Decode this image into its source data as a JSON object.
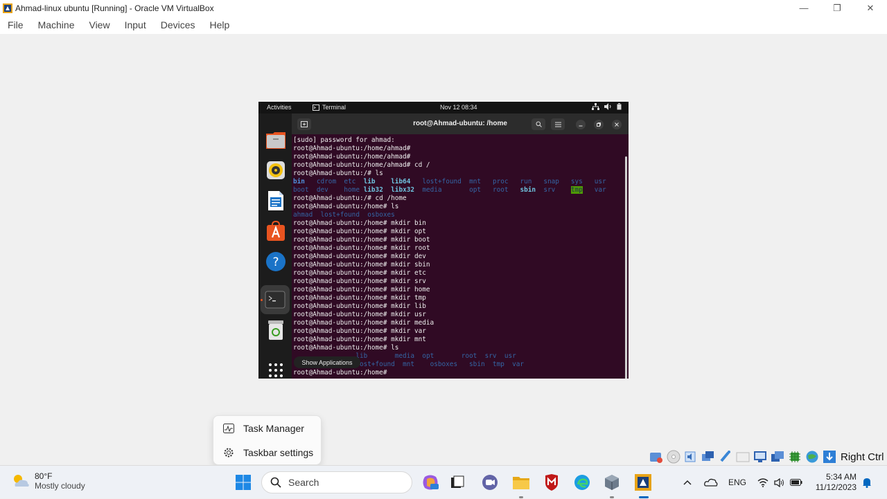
{
  "window": {
    "title": "Ahmad-linux ubuntu [Running] - Oracle VM VirtualBox",
    "minimize": "—",
    "restore": "❐",
    "close": "✕"
  },
  "menubar": {
    "items": [
      "File",
      "Machine",
      "View",
      "Input",
      "Devices",
      "Help"
    ]
  },
  "vm": {
    "topbar": {
      "activities": "Activities",
      "app": "Terminal",
      "clock": "Nov 12  08:34"
    },
    "terminal": {
      "title": "root@Ahmad-ubuntu: /home",
      "lines": [
        "[sudo] password for ahmad:",
        "root@Ahmad-ubuntu:/home/ahmad#",
        "root@Ahmad-ubuntu:/home/ahmad#",
        "root@Ahmad-ubuntu:/home/ahmad# cd /",
        "root@Ahmad-ubuntu:/# ls"
      ],
      "ls_root_row1": [
        "bin",
        "cdrom",
        "etc",
        "lib",
        "lib64",
        "lost+found",
        "mnt",
        "proc",
        "run",
        "snap",
        "sys",
        "usr"
      ],
      "ls_root_row2": [
        "boot",
        "dev",
        "home",
        "lib32",
        "libx32",
        "media",
        "opt",
        "root",
        "sbin",
        "srv",
        "tmp",
        "var"
      ],
      "lines2": [
        "root@Ahmad-ubuntu:/# cd /home",
        "root@Ahmad-ubuntu:/home# ls"
      ],
      "ls_home": [
        "ahmad",
        "lost+found",
        "osboxes"
      ],
      "lines3": [
        "root@Ahmad-ubuntu:/home# mkdir bin",
        "root@Ahmad-ubuntu:/home# mkdir opt",
        "root@Ahmad-ubuntu:/home# mkdir boot",
        "root@Ahmad-ubuntu:/home# mkdir root",
        "root@Ahmad-ubuntu:/home# mkdir dev",
        "root@Ahmad-ubuntu:/home# mkdir sbin",
        "root@Ahmad-ubuntu:/home# mkdir etc",
        "root@Ahmad-ubuntu:/home# mkdir srv",
        "root@Ahmad-ubuntu:/home# mkdir home",
        "root@Ahmad-ubuntu:/home# mkdir tmp",
        "root@Ahmad-ubuntu:/home# mkdir lib",
        "root@Ahmad-ubuntu:/home# mkdir usr",
        "root@Ahmad-ubuntu:/home# mkdir media",
        "root@Ahmad-ubuntu:/home# mkdir var",
        "root@Ahmad-ubuntu:/home# mkdir mnt",
        "root@Ahmad-ubuntu:/home# ls"
      ],
      "ls_final_row1": [
        "lib",
        "media",
        "opt",
        "root",
        "srv",
        "usr"
      ],
      "ls_final_row2": [
        "lost+found",
        "mnt",
        "osboxes",
        "sbin",
        "tmp",
        "var"
      ],
      "prompt": "root@Ahmad-ubuntu:/home#"
    },
    "dock_tooltip": "Show Applications"
  },
  "context_menu": {
    "task_manager": "Task Manager",
    "taskbar_settings": "Taskbar settings"
  },
  "vbox_status": {
    "host_key": "Right Ctrl"
  },
  "taskbar": {
    "weather_temp": "80°F",
    "weather_cond": "Mostly cloudy",
    "search": "Search",
    "lang": "ENG",
    "time": "5:34 AM",
    "date": "11/12/2023"
  },
  "colors": {
    "ubuntu_bg": "#300a24",
    "dir": "#3465a4",
    "accent": "#0067c0"
  }
}
